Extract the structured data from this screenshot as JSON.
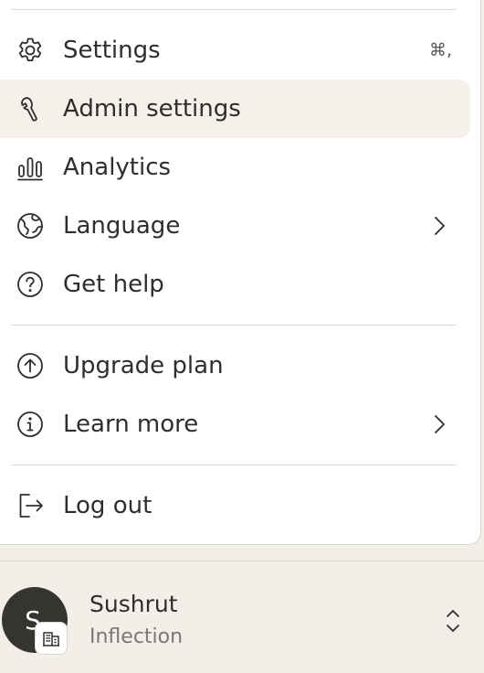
{
  "menu": {
    "items": [
      {
        "id": "settings",
        "label": "Settings",
        "icon": "gear-icon",
        "shortcut": "⌘,"
      },
      {
        "id": "admin-settings",
        "label": "Admin settings",
        "icon": "wrench-icon",
        "highlighted": true
      },
      {
        "id": "analytics",
        "label": "Analytics",
        "icon": "bar-chart-icon"
      },
      {
        "id": "language",
        "label": "Language",
        "icon": "globe-icon",
        "has_submenu": true
      },
      {
        "id": "get-help",
        "label": "Get help",
        "icon": "question-circle-icon"
      },
      {
        "id": "upgrade-plan",
        "label": "Upgrade plan",
        "icon": "arrow-up-circle-icon"
      },
      {
        "id": "learn-more",
        "label": "Learn more",
        "icon": "info-circle-icon",
        "has_submenu": true
      },
      {
        "id": "log-out",
        "label": "Log out",
        "icon": "logout-icon"
      }
    ]
  },
  "user": {
    "initial": "S",
    "name": "Sushrut",
    "organization": "Inflection",
    "badge_icon": "building-icon"
  },
  "colors": {
    "panel": "#ffffff",
    "highlight": "#f3f1ea",
    "footer": "#f1efe8",
    "text": "#2f2e2b",
    "muted": "#7a7872",
    "avatar": "#363431"
  }
}
